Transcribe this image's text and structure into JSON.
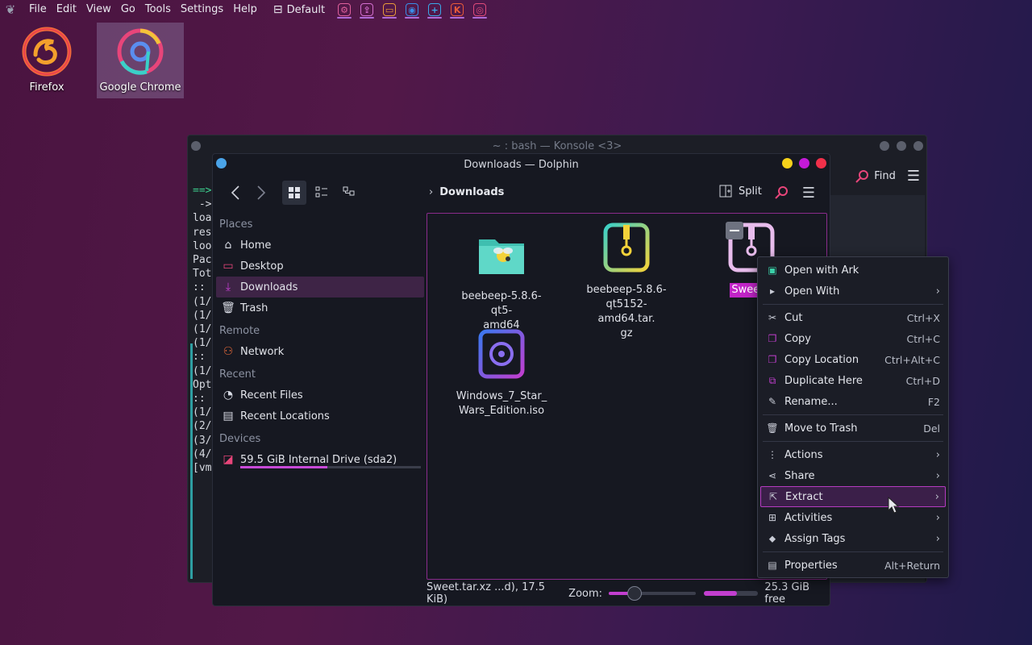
{
  "panel": {
    "menus": [
      "File",
      "Edit",
      "View",
      "Go",
      "Tools",
      "Settings",
      "Help"
    ],
    "layout_label": "Default",
    "tasks": [
      {
        "name": "settings",
        "color": "#e0609c",
        "glyph": "⚙"
      },
      {
        "name": "updater",
        "color": "#d46fd0",
        "glyph": "⇪"
      },
      {
        "name": "dolphin",
        "color": "#e89a3a",
        "glyph": "▭",
        "active": true
      },
      {
        "name": "firefox",
        "color": "#3a8ee8",
        "glyph": "◉"
      },
      {
        "name": "discover",
        "color": "#3aa8e8",
        "glyph": "+"
      },
      {
        "name": "kvantum",
        "color": "#e85a3a",
        "glyph": "K"
      },
      {
        "name": "chrome",
        "color": "#e04a7a",
        "glyph": "◎"
      }
    ]
  },
  "desktop": {
    "icons": [
      {
        "label": "Firefox"
      },
      {
        "label": "Google Chrome"
      }
    ]
  },
  "konsole": {
    "title": "~ : bash — Konsole <3>",
    "lines": [
      "==>",
      " ->",
      "loa",
      "res",
      "loo",
      "",
      "Pac",
      "",
      "Tot",
      "",
      ":: ",
      "(1/",
      "(1/",
      "(1/",
      "(1/",
      ":: ",
      "(1/",
      "Opt",
      "",
      "",
      "",
      ":: ",
      "(1/",
      "(2/",
      "(3/",
      "(4/",
      "[vm"
    ],
    "find_label": "Find"
  },
  "dolphin": {
    "title": "Downloads — Dolphin",
    "breadcrumb": "Downloads",
    "split_label": "Split",
    "sidebar": {
      "places_header": "Places",
      "places": [
        {
          "label": "Home",
          "icon": "home-icon"
        },
        {
          "label": "Desktop",
          "icon": "desktop-icon"
        },
        {
          "label": "Downloads",
          "icon": "download-icon",
          "active": true
        },
        {
          "label": "Trash",
          "icon": "trash-icon"
        }
      ],
      "remote_header": "Remote",
      "remote": [
        {
          "label": "Network",
          "icon": "network-icon"
        }
      ],
      "recent_header": "Recent",
      "recent": [
        {
          "label": "Recent Files",
          "icon": "recent-files-icon"
        },
        {
          "label": "Recent Locations",
          "icon": "recent-locations-icon"
        }
      ],
      "devices_header": "Devices",
      "devices": [
        {
          "label": "59.5 GiB Internal Drive (sda2)",
          "icon": "drive-icon",
          "usage": 0.48
        }
      ]
    },
    "files": [
      {
        "name": "beebeep-5.8.6-qt5-amd64",
        "lines": [
          "beebeep-5.8.6-qt5-",
          "amd64"
        ],
        "type": "folder"
      },
      {
        "name": "beebeep-5.8.6-qt5152-amd64.tar.gz",
        "lines": [
          "beebeep-5.8.6-",
          "qt5152-amd64.tar.",
          "gz"
        ],
        "type": "archive"
      },
      {
        "name": "Sweet.tar.xz",
        "lines": [
          "Sweet.t"
        ],
        "type": "archive",
        "selected": true
      },
      {
        "name": "Windows_7_Star_Wars_Edition.iso",
        "lines": [
          "Windows_7_Star_",
          "Wars_Edition.iso"
        ],
        "type": "iso"
      }
    ],
    "status": {
      "text": "Sweet.tar.xz ...d), 17.5 KiB)",
      "zoom_label": "Zoom:",
      "zoom_level": 0.28,
      "free_label": "25.3 GiB free",
      "used_fraction": 0.61
    }
  },
  "context_menu": {
    "groups": [
      [
        {
          "label": "Open with Ark",
          "icon": "ark-icon",
          "shortcut": "",
          "submenu": false
        },
        {
          "label": "Open With",
          "icon": "open-with-icon",
          "shortcut": "",
          "submenu": true
        }
      ],
      [
        {
          "label": "Cut",
          "icon": "scissors-icon",
          "shortcut": "Ctrl+X",
          "submenu": false
        },
        {
          "label": "Copy",
          "icon": "copy-icon",
          "shortcut": "Ctrl+C",
          "submenu": false
        },
        {
          "label": "Copy Location",
          "icon": "copy-location-icon",
          "shortcut": "Ctrl+Alt+C",
          "submenu": false
        },
        {
          "label": "Duplicate Here",
          "icon": "duplicate-icon",
          "shortcut": "Ctrl+D",
          "submenu": false
        },
        {
          "label": "Rename...",
          "icon": "pencil-icon",
          "shortcut": "F2",
          "submenu": false
        }
      ],
      [
        {
          "label": "Move to Trash",
          "icon": "trash-icon",
          "shortcut": "Del",
          "submenu": false
        }
      ],
      [
        {
          "label": "Actions",
          "icon": "kebab-icon",
          "shortcut": "",
          "submenu": true
        },
        {
          "label": "Share",
          "icon": "share-icon",
          "shortcut": "",
          "submenu": true
        },
        {
          "label": "Extract",
          "icon": "extract-icon",
          "shortcut": "",
          "submenu": true,
          "hover": true
        },
        {
          "label": "Activities",
          "icon": "activities-icon",
          "shortcut": "",
          "submenu": true
        },
        {
          "label": "Assign Tags",
          "icon": "tag-icon",
          "shortcut": "",
          "submenu": true
        }
      ],
      [
        {
          "label": "Properties",
          "icon": "properties-icon",
          "shortcut": "Alt+Return",
          "submenu": false
        }
      ]
    ]
  }
}
